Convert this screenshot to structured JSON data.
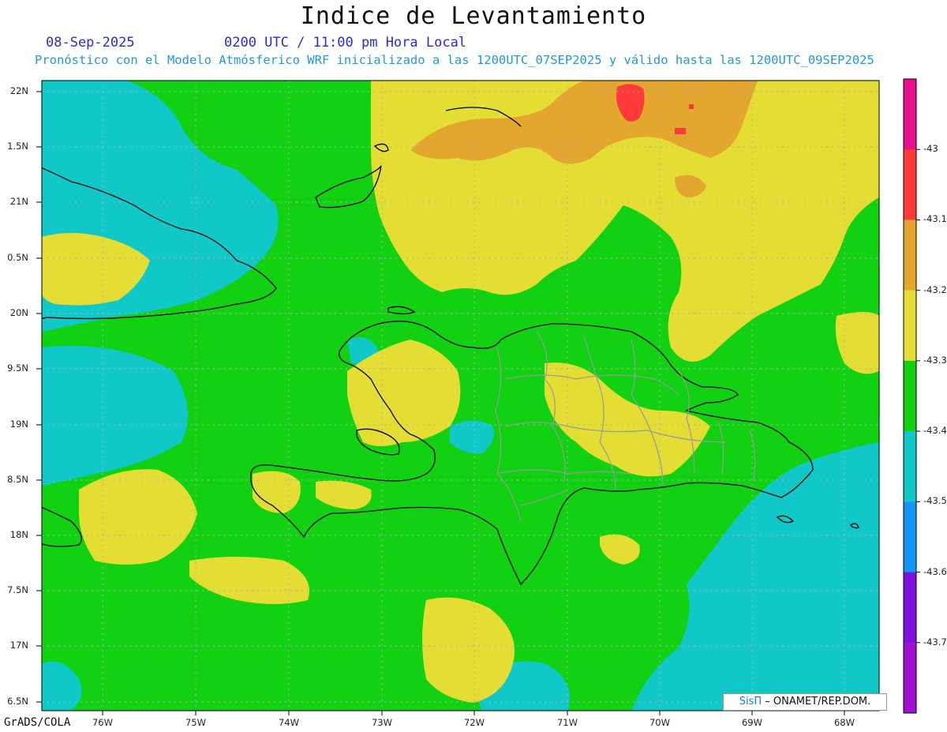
{
  "header": {
    "title": "Indice de Levantamiento",
    "date": "08-Sep-2025",
    "time": "0200 UTC / 11:00 pm Hora Local",
    "subtitle": "Pronóstico con el Modelo Atmósferico WRF inicializado a las 1200UTC_07SEP2025 y válido hasta las  1200UTC_09SEP2025"
  },
  "axes": {
    "lat_labels": [
      "22N",
      "1.5N",
      "21N",
      "0.5N",
      "20N",
      "9.5N",
      "19N",
      "8.5N",
      "18N",
      "7.5N",
      "17N",
      "6.5N"
    ],
    "lon_labels": [
      "76W",
      "75W",
      "74W",
      "73W",
      "72W",
      "71W",
      "70W",
      "69W",
      "68W"
    ]
  },
  "colorbar": {
    "labels": [
      "-43",
      "-43.1",
      "-43.2",
      "-43.3",
      "-43.4",
      "-43.5",
      "-43.6",
      "-43.7"
    ],
    "colors": [
      "#e8108c",
      "#fe3a3a",
      "#e3a72f",
      "#e3dd34",
      "#12d012",
      "#10c8c8",
      "#1496f8",
      "#7d12e0",
      "#a010d0"
    ]
  },
  "footer": {
    "left": "GrADS/COLA",
    "credit_brand": "SisΠ",
    "credit_rest": " – ONAMET/REP.DOM."
  },
  "fields": {
    "base_color": "#12d012",
    "cyan": "#10c8c8",
    "yellow": "#e3dd34",
    "orange": "#e3a72f",
    "red": "#fe3a3a",
    "coast": "#000000",
    "province": "#9a9a9a"
  }
}
